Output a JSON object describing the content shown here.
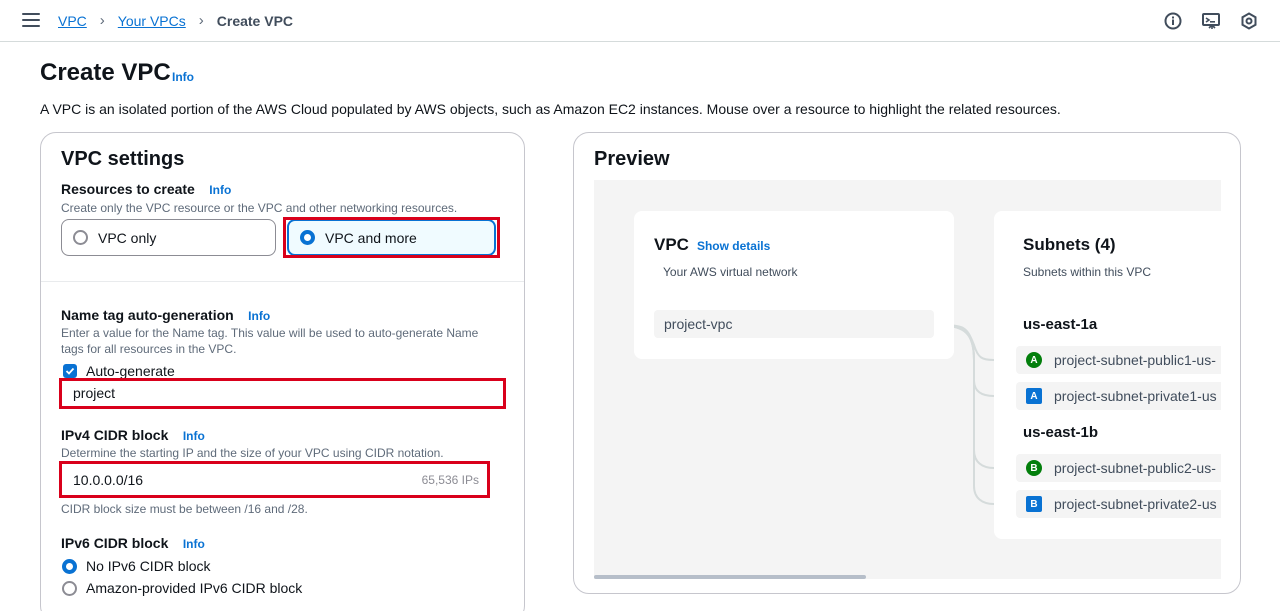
{
  "breadcrumb": {
    "items": [
      "VPC",
      "Your VPCs"
    ],
    "current": "Create VPC"
  },
  "page": {
    "title": "Create VPC",
    "info": "Info",
    "description": "A VPC is an isolated portion of the AWS Cloud populated by AWS objects, such as Amazon EC2 instances. Mouse over a resource to highlight the related resources."
  },
  "settings": {
    "title": "VPC settings",
    "resources": {
      "label": "Resources to create",
      "info": "Info",
      "description": "Create only the VPC resource or the VPC and other networking resources.",
      "options": [
        "VPC only",
        "VPC and more"
      ],
      "selected": "VPC and more"
    },
    "name_tag": {
      "label": "Name tag auto-generation",
      "info": "Info",
      "description": "Enter a value for the Name tag. This value will be used to auto-generate Name tags for all resources in the VPC.",
      "checkbox_label": "Auto-generate",
      "checked": true,
      "value": "project"
    },
    "ipv4": {
      "label": "IPv4 CIDR block",
      "info": "Info",
      "description": "Determine the starting IP and the size of your VPC using CIDR notation.",
      "value": "10.0.0.0/16",
      "suffix": "65,536 IPs",
      "constraint": "CIDR block size must be between /16 and /28."
    },
    "ipv6": {
      "label": "IPv6 CIDR block",
      "info": "Info",
      "options": [
        "No IPv6 CIDR block",
        "Amazon-provided IPv6 CIDR block"
      ],
      "selected": "No IPv6 CIDR block"
    }
  },
  "preview": {
    "title": "Preview",
    "vpc": {
      "title": "VPC",
      "link": "Show details",
      "subtitle": "Your AWS virtual network",
      "name": "project-vpc"
    },
    "subnets": {
      "title": "Subnets (4)",
      "subtitle": "Subnets within this VPC",
      "zones": [
        {
          "name": "us-east-1a",
          "items": [
            {
              "badge": "A",
              "color": "green",
              "label": "project-subnet-public1-us-"
            },
            {
              "badge": "A",
              "color": "blue",
              "label": "project-subnet-private1-us"
            }
          ]
        },
        {
          "name": "us-east-1b",
          "items": [
            {
              "badge": "B",
              "color": "green",
              "label": "project-subnet-public2-us-"
            },
            {
              "badge": "B",
              "color": "blue",
              "label": "project-subnet-private2-us"
            }
          ]
        }
      ]
    }
  },
  "colors": {
    "accent": "#0972d3",
    "highlight": "#d9001b",
    "public": "#037f0c"
  },
  "icons": [
    "menu-icon",
    "info-circle-icon",
    "terminal-icon",
    "settings-hex-icon"
  ]
}
